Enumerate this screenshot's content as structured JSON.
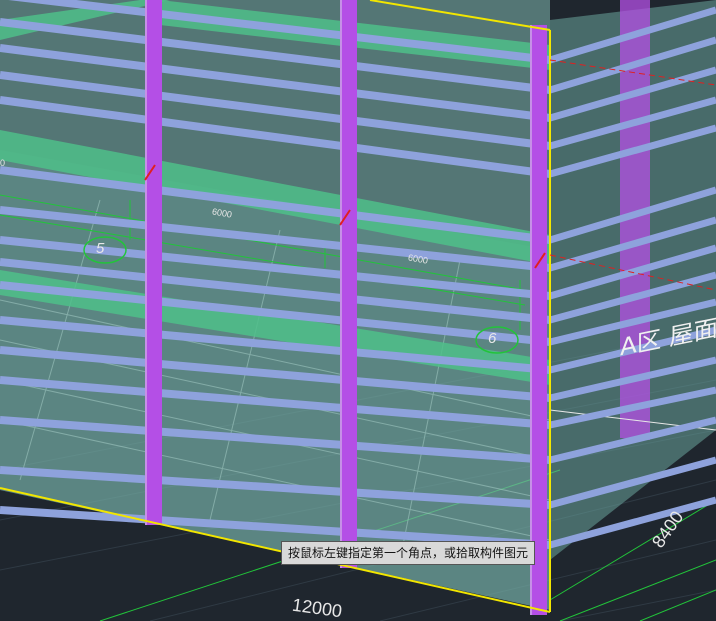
{
  "tooltip": {
    "text": "按鼠标左键指定第一个角点，或拾取构件图元"
  },
  "dimensions": {
    "bottom": "12000",
    "right": "8400",
    "grid_span_1": "6000",
    "grid_span_2": "6000",
    "grid_left": "0"
  },
  "axis_bubbles": {
    "axis_5": "5",
    "axis_6": "6"
  },
  "zone_label": {
    "text": "A区 屋面"
  },
  "colors": {
    "background": "#1f262e",
    "column": "#b44fe6",
    "beam": "#8ea2dc",
    "green_beam": "#4fbf8a",
    "slab_edge": "#f2e600",
    "grid": "#22c43a",
    "axis_red": "#e02020",
    "glass": "#7fb8b0"
  }
}
